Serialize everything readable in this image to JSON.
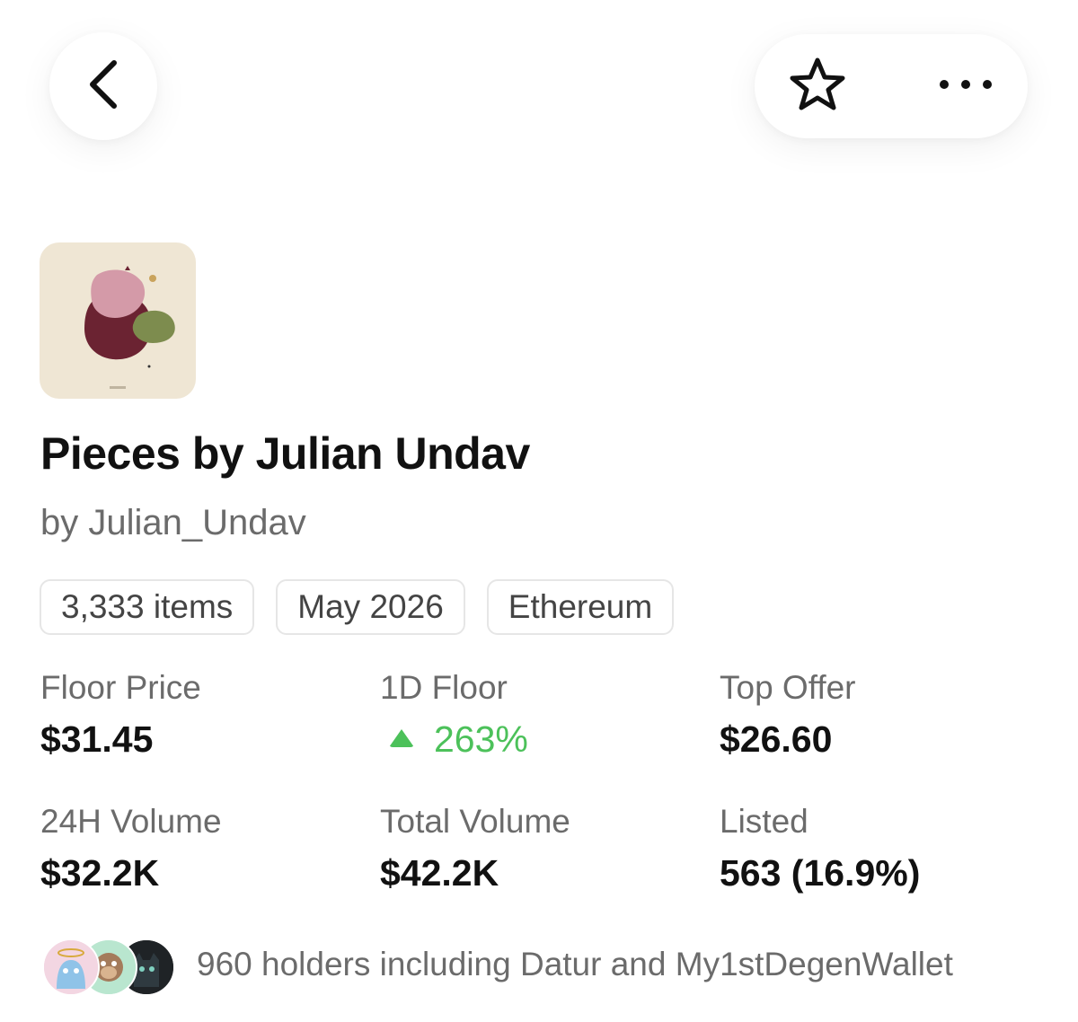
{
  "header": {
    "back_icon": "chevron-left-icon",
    "favorite_icon": "star-outline-icon",
    "more_icon": "ellipsis-horizontal-icon"
  },
  "collection": {
    "title": "Pieces by Julian Undav",
    "creator": "by Julian_Undav",
    "image_bg": "#efe6d4"
  },
  "chips": [
    {
      "label": "3,333 items"
    },
    {
      "label": "May 2026"
    },
    {
      "label": "Ethereum"
    }
  ],
  "stats": {
    "floor_price": {
      "label": "Floor Price",
      "value": "$31.45"
    },
    "floor_1d": {
      "label": "1D Floor",
      "value": "263%",
      "direction": "up",
      "color": "#4cc15a"
    },
    "top_offer": {
      "label": "Top Offer",
      "value": "$26.60"
    },
    "volume_24h": {
      "label": "24H Volume",
      "value": "$32.2K"
    },
    "total_volume": {
      "label": "Total Volume",
      "value": "$42.2K"
    },
    "listed": {
      "label": "Listed",
      "value": "563 (16.9%)"
    }
  },
  "holders": {
    "text": "960 holders including Datur and My1stDegenWallet"
  }
}
